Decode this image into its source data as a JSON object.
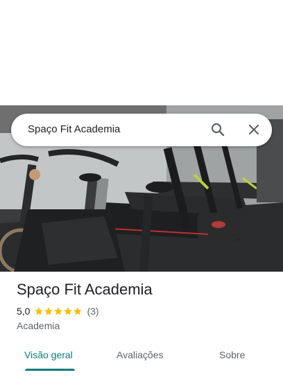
{
  "search": {
    "query": "Spaço Fit Academia"
  },
  "place": {
    "title": "Spaço Fit Academia",
    "rating": "5,0",
    "stars": 5,
    "reviews": "(3)",
    "category": "Academia"
  },
  "tabs": [
    {
      "label": "Visão geral",
      "active": true
    },
    {
      "label": "Avaliações",
      "active": false
    },
    {
      "label": "Sobre",
      "active": false
    }
  ],
  "colors": {
    "accent": "#0b7b7d",
    "star": "#fbbc04"
  }
}
